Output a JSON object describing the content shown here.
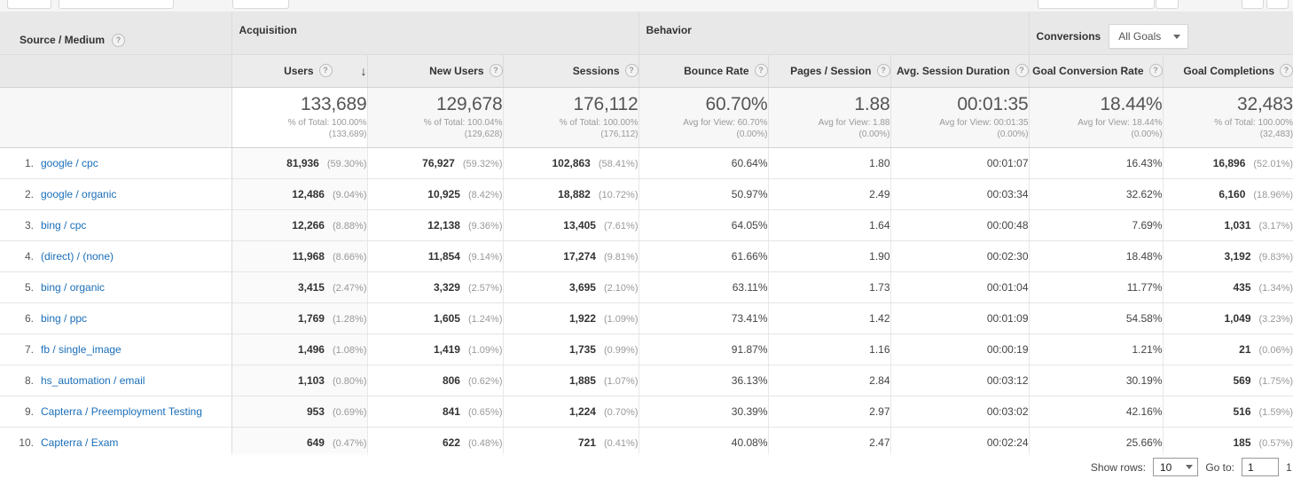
{
  "table": {
    "dimension_header": {
      "label": "Source / Medium",
      "help_icon": "help-icon",
      "help_glyph": "?"
    },
    "groups": [
      {
        "name": "acquisition",
        "label": "Acquisition"
      },
      {
        "name": "behavior",
        "label": "Behavior"
      },
      {
        "name": "conversions",
        "label": "Conversions",
        "select_value": "All Goals"
      }
    ],
    "columns": [
      {
        "key": "users",
        "label": "Users",
        "sorted": true,
        "sort_dir": "descending",
        "sort_glyph": "↓"
      },
      {
        "key": "new_users",
        "label": "New Users",
        "sorted": false
      },
      {
        "key": "sessions",
        "label": "Sessions",
        "sorted": false
      },
      {
        "key": "bounce_rate",
        "label": "Bounce Rate",
        "sorted": false
      },
      {
        "key": "pages_session",
        "label": "Pages / Session",
        "sorted": false
      },
      {
        "key": "avg_duration",
        "label": "Avg. Session Duration",
        "sorted": false
      },
      {
        "key": "goal_conv_rate",
        "label": "Goal Conversion Rate",
        "sorted": false
      },
      {
        "key": "goal_completions",
        "label": "Goal Completions",
        "sorted": false
      }
    ],
    "summary": [
      {
        "value": "133,689",
        "line1": "% of Total: 100.00%",
        "line2": "(133,689)"
      },
      {
        "value": "129,678",
        "line1": "% of Total: 100.04%",
        "line2": "(129,628)"
      },
      {
        "value": "176,112",
        "line1": "% of Total: 100.00%",
        "line2": "(176,112)"
      },
      {
        "value": "60.70%",
        "line1": "Avg for View: 60.70%",
        "line2": "(0.00%)"
      },
      {
        "value": "1.88",
        "line1": "Avg for View: 1.88",
        "line2": "(0.00%)"
      },
      {
        "value": "00:01:35",
        "line1": "Avg for View: 00:01:35",
        "line2": "(0.00%)"
      },
      {
        "value": "18.44%",
        "line1": "Avg for View: 18.44%",
        "line2": "(0.00%)"
      },
      {
        "value": "32,483",
        "line1": "% of Total: 100.00%",
        "line2": "(32,483)"
      }
    ],
    "rows": [
      {
        "num": "1.",
        "source": "google / cpc",
        "users": "81,936",
        "users_pct": "(59.30%)",
        "new_users": "76,927",
        "new_users_pct": "(59.32%)",
        "sessions": "102,863",
        "sessions_pct": "(58.41%)",
        "bounce_rate": "60.64%",
        "pages_session": "1.80",
        "avg_duration": "00:01:07",
        "goal_conv_rate": "16.43%",
        "goal_completions": "16,896",
        "goal_completions_pct": "(52.01%)"
      },
      {
        "num": "2.",
        "source": "google / organic",
        "users": "12,486",
        "users_pct": "(9.04%)",
        "new_users": "10,925",
        "new_users_pct": "(8.42%)",
        "sessions": "18,882",
        "sessions_pct": "(10.72%)",
        "bounce_rate": "50.97%",
        "pages_session": "2.49",
        "avg_duration": "00:03:34",
        "goal_conv_rate": "32.62%",
        "goal_completions": "6,160",
        "goal_completions_pct": "(18.96%)"
      },
      {
        "num": "3.",
        "source": "bing / cpc",
        "users": "12,266",
        "users_pct": "(8.88%)",
        "new_users": "12,138",
        "new_users_pct": "(9.36%)",
        "sessions": "13,405",
        "sessions_pct": "(7.61%)",
        "bounce_rate": "64.05%",
        "pages_session": "1.64",
        "avg_duration": "00:00:48",
        "goal_conv_rate": "7.69%",
        "goal_completions": "1,031",
        "goal_completions_pct": "(3.17%)"
      },
      {
        "num": "4.",
        "source": "(direct) / (none)",
        "users": "11,968",
        "users_pct": "(8.66%)",
        "new_users": "11,854",
        "new_users_pct": "(9.14%)",
        "sessions": "17,274",
        "sessions_pct": "(9.81%)",
        "bounce_rate": "61.66%",
        "pages_session": "1.90",
        "avg_duration": "00:02:30",
        "goal_conv_rate": "18.48%",
        "goal_completions": "3,192",
        "goal_completions_pct": "(9.83%)"
      },
      {
        "num": "5.",
        "source": "bing / organic",
        "users": "3,415",
        "users_pct": "(2.47%)",
        "new_users": "3,329",
        "new_users_pct": "(2.57%)",
        "sessions": "3,695",
        "sessions_pct": "(2.10%)",
        "bounce_rate": "63.11%",
        "pages_session": "1.73",
        "avg_duration": "00:01:04",
        "goal_conv_rate": "11.77%",
        "goal_completions": "435",
        "goal_completions_pct": "(1.34%)"
      },
      {
        "num": "6.",
        "source": "bing / ppc",
        "users": "1,769",
        "users_pct": "(1.28%)",
        "new_users": "1,605",
        "new_users_pct": "(1.24%)",
        "sessions": "1,922",
        "sessions_pct": "(1.09%)",
        "bounce_rate": "73.41%",
        "pages_session": "1.42",
        "avg_duration": "00:01:09",
        "goal_conv_rate": "54.58%",
        "goal_completions": "1,049",
        "goal_completions_pct": "(3.23%)"
      },
      {
        "num": "7.",
        "source": "fb / single_image",
        "users": "1,496",
        "users_pct": "(1.08%)",
        "new_users": "1,419",
        "new_users_pct": "(1.09%)",
        "sessions": "1,735",
        "sessions_pct": "(0.99%)",
        "bounce_rate": "91.87%",
        "pages_session": "1.16",
        "avg_duration": "00:00:19",
        "goal_conv_rate": "1.21%",
        "goal_completions": "21",
        "goal_completions_pct": "(0.06%)"
      },
      {
        "num": "8.",
        "source": "hs_automation / email",
        "users": "1,103",
        "users_pct": "(0.80%)",
        "new_users": "806",
        "new_users_pct": "(0.62%)",
        "sessions": "1,885",
        "sessions_pct": "(1.07%)",
        "bounce_rate": "36.13%",
        "pages_session": "2.84",
        "avg_duration": "00:03:12",
        "goal_conv_rate": "30.19%",
        "goal_completions": "569",
        "goal_completions_pct": "(1.75%)"
      },
      {
        "num": "9.",
        "source": "Capterra / Preemployment Testing",
        "users": "953",
        "users_pct": "(0.69%)",
        "new_users": "841",
        "new_users_pct": "(0.65%)",
        "sessions": "1,224",
        "sessions_pct": "(0.70%)",
        "bounce_rate": "30.39%",
        "pages_session": "2.97",
        "avg_duration": "00:03:02",
        "goal_conv_rate": "42.16%",
        "goal_completions": "516",
        "goal_completions_pct": "(1.59%)"
      },
      {
        "num": "10.",
        "source": "Capterra / Exam",
        "users": "649",
        "users_pct": "(0.47%)",
        "new_users": "622",
        "new_users_pct": "(0.48%)",
        "sessions": "721",
        "sessions_pct": "(0.41%)",
        "bounce_rate": "40.08%",
        "pages_session": "2.47",
        "avg_duration": "00:02:24",
        "goal_conv_rate": "25.66%",
        "goal_completions": "185",
        "goal_completions_pct": "(0.57%)"
      }
    ]
  },
  "footer": {
    "show_rows_label": "Show rows:",
    "show_rows_value": "10",
    "goto_label": "Go to:",
    "goto_value": "1",
    "page_info": "1"
  },
  "colors": {
    "link": "#1a6eb8",
    "header_group_bg": "#e8e8e8",
    "header_metric_bg": "#ececec",
    "summary_bg": "#f7f7f7",
    "sorted_col_bg": "#fafafa"
  }
}
